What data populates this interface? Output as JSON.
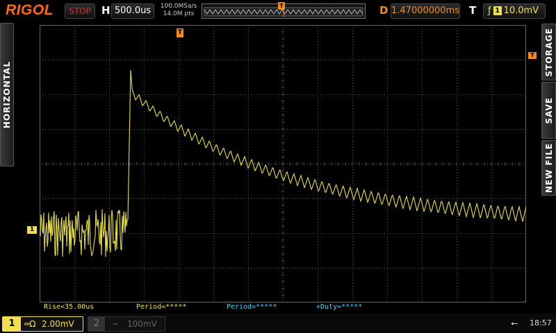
{
  "topbar": {
    "logo": "RIGOL",
    "run_status": "STOP",
    "h_label": "H",
    "timebase": "500.0us",
    "sample_rate": "100.0MSa/s",
    "memory_depth": "14.0M pts",
    "memory_trigger_glyph": "T",
    "d_label": "D",
    "delay": "1.47000000ms",
    "t_label": "T",
    "trigger_edge_glyph": "ƒ",
    "trigger_channel": "1",
    "trigger_level": "10.0mV"
  },
  "side_tabs": {
    "horizontal": "HORIZONTAL",
    "storage": "STORAGE",
    "save": "SAVE",
    "new_file": "NEW FILE"
  },
  "markers": {
    "ch1": "1",
    "trigger_pos": "T",
    "trigger_level": "T"
  },
  "measurements": {
    "rise": "Rise<35.00us",
    "period1": "Period=*****",
    "period2": "Period=*****",
    "duty": "+Duty=*****"
  },
  "bottombar": {
    "ch1_num": "1",
    "ch1_coupling": "═Ω",
    "ch1_scale": "2.00mV",
    "ch2_num": "2",
    "ch2_coupling": "~",
    "ch2_scale": "100mV",
    "usb_glyph": "⭠",
    "clock": "18:57"
  },
  "colors": {
    "ch1": "#f0e050",
    "accent": "#f08a1e",
    "measure_ch2": "#40d8ff",
    "stop": "#e22222"
  },
  "waveform": {
    "channel": "1",
    "noise_until_fraction": 0.18,
    "peak_fraction": 0.19,
    "baseline_div": 0,
    "peak_div": 4.7,
    "decay_end_div": 0.3,
    "ripple_cycles": 56
  }
}
